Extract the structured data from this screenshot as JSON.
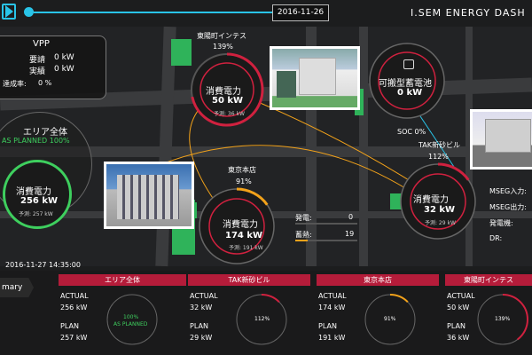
{
  "topbar": {
    "date": "2016-11-26",
    "title": "I.SEM ENERGY DASH"
  },
  "vpp": {
    "title": "VPP",
    "request_label": "要請",
    "request_value": "0 kW",
    "actual_label": "実績",
    "actual_value": "0 kW",
    "rate_label": "達成率:",
    "rate_value": "0 %"
  },
  "area_total": {
    "name": "エリア全体",
    "status": "AS PLANNED 100%",
    "power_label": "消費電力",
    "power_value": "256 kW",
    "forecast": "予測: 257 kW"
  },
  "higashi": {
    "name": "東陽町インテス",
    "percent": "139%",
    "power_label": "消費電力",
    "power_value": "50 kW",
    "forecast": "予測: 36 kW"
  },
  "battery": {
    "label": "可搬型蓄電池",
    "value": "0 kW",
    "soc": "SOC 0%"
  },
  "tak": {
    "name": "TAK新砂ビル",
    "percent": "112%",
    "power_label": "消費電力",
    "power_value": "32 kW",
    "forecast": "予測: 29 kW"
  },
  "tokyo": {
    "name": "東京本店",
    "percent": "91%",
    "power_label": "消費電力",
    "power_value": "174 kW",
    "forecast": "予測: 191 kW",
    "gen_label": "発電:",
    "gen_value": "0",
    "store_label": "蓄熱:",
    "store_value": "19"
  },
  "mseg": {
    "in_label": "MSEG入力:",
    "out_label": "MSEG出力:",
    "gen_label": "発電機:",
    "dr_label": "DR:"
  },
  "timestamp": "2016-11-27 14:35:00",
  "summary": {
    "label": "mary",
    "cards": [
      {
        "title": "エリア全体",
        "actual_label": "ACTUAL",
        "actual": "256 kW",
        "plan_label": "PLAN",
        "plan": "257 kW",
        "ring_text1": "100%",
        "ring_text2": "AS PLANNED"
      },
      {
        "title": "TAK新砂ビル",
        "actual_label": "ACTUAL",
        "actual": "32 kW",
        "plan_label": "PLAN",
        "plan": "29 kW",
        "ring_text1": "112%",
        "ring_text2": ""
      },
      {
        "title": "東京本店",
        "actual_label": "ACTUAL",
        "actual": "174 kW",
        "plan_label": "PLAN",
        "plan": "191 kW",
        "ring_text1": "91%",
        "ring_text2": ""
      },
      {
        "title": "東陽町インテス",
        "actual_label": "ACTUAL",
        "actual": "50 kW",
        "plan_label": "PLAN",
        "plan": "36 kW",
        "ring_text1": "139%",
        "ring_text2": ""
      }
    ]
  },
  "colors": {
    "accent": "#29c4e8",
    "red": "#d0213f",
    "green": "#3ecf5e",
    "orange": "#f2a21a",
    "card_title": "#b51c3a"
  }
}
